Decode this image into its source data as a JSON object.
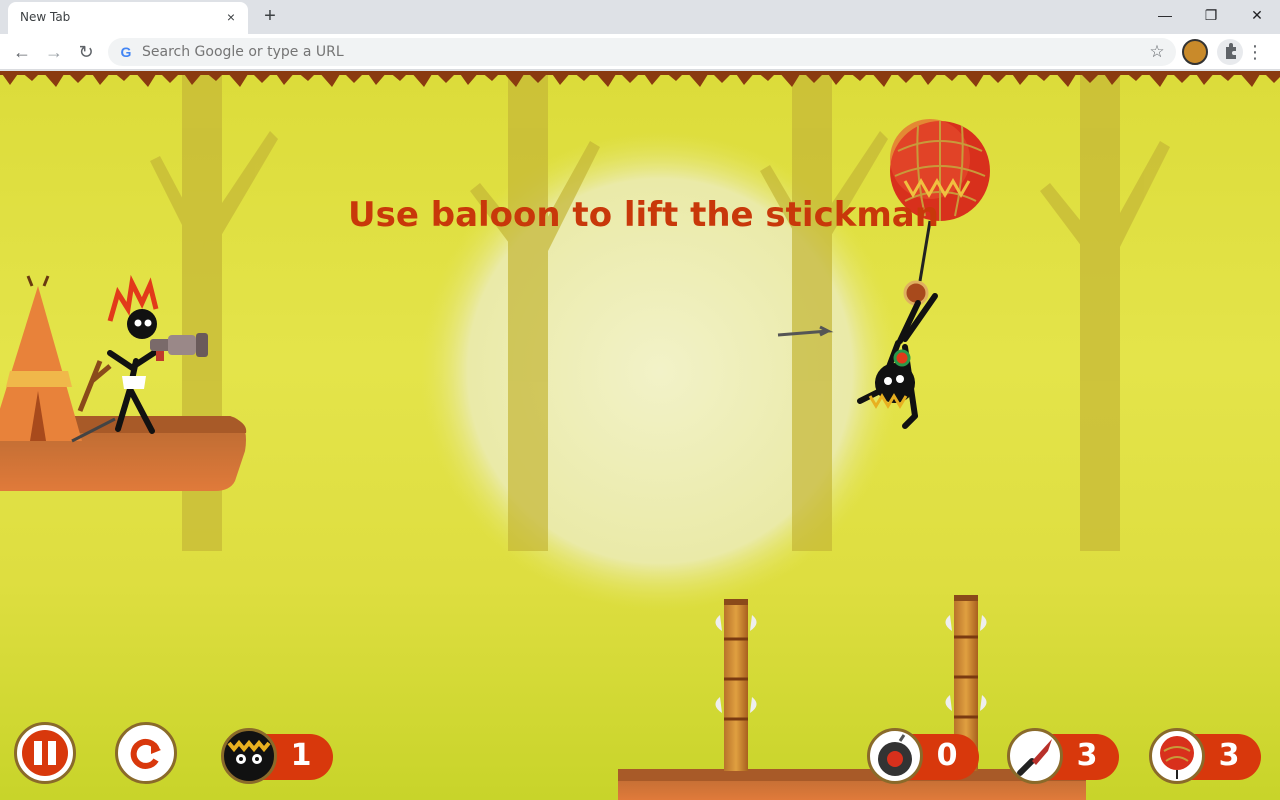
{
  "browser": {
    "tab_title": "New Tab",
    "tab_close_icon": "×",
    "new_tab_icon": "+",
    "minimize_icon": "—",
    "restore_icon": "❐",
    "close_window_icon": "✕",
    "back_icon": "←",
    "forward_icon": "→",
    "reload_icon": "↻",
    "omnibox_placeholder": "Search Google or type a URL",
    "google_icon": "G",
    "star_icon": "☆",
    "menu_icon": "⋮"
  },
  "game": {
    "hint": "Use baloon to lift  the stickman",
    "counters": {
      "enemies": "1",
      "bombs": "0",
      "knives": "3",
      "balloons": "3"
    },
    "colors": {
      "accent": "#d8380c",
      "hint": "#c8380a"
    }
  }
}
